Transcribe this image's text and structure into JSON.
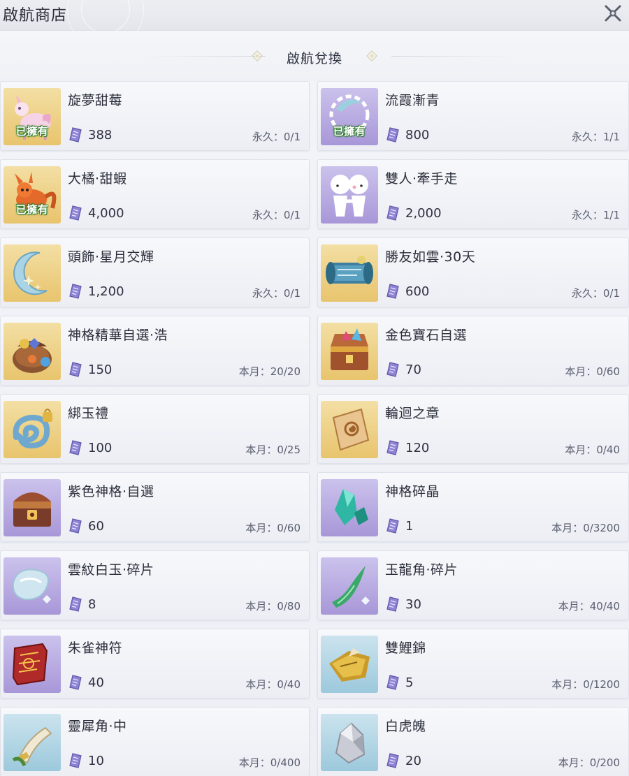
{
  "window": {
    "title": "啟航商店"
  },
  "section": {
    "title": "啟航兌換"
  },
  "owned_label": "已擁有",
  "colors": {
    "owned_outline": "#2f7d2e",
    "ticket": "#7b72c4"
  },
  "items": [
    {
      "name": "旋夢甜莓",
      "price": "388",
      "limit": "永久：0/1",
      "owned": true,
      "thumb_bg": "gold",
      "icon": "dream-berry-mount-icon"
    },
    {
      "name": "流霞漸青",
      "price": "800",
      "limit": "永久：1/1",
      "owned": true,
      "thumb_bg": "purple",
      "icon": "moon-wreath-icon"
    },
    {
      "name": "大橘·甜蝦",
      "price": "4,000",
      "limit": "永久：0/1",
      "owned": true,
      "thumb_bg": "gold",
      "icon": "orange-fox-pet-icon"
    },
    {
      "name": "雙人·牽手走",
      "price": "2,000",
      "limit": "永久：1/1",
      "owned": false,
      "thumb_bg": "purple",
      "icon": "holding-hands-emote-icon"
    },
    {
      "name": "頭飾·星月交輝",
      "price": "1,200",
      "limit": "永久：0/1",
      "owned": false,
      "thumb_bg": "gold",
      "icon": "crescent-moon-headwear-icon"
    },
    {
      "name": "勝友如雲·30天",
      "price": "600",
      "limit": "永久：0/1",
      "owned": false,
      "thumb_bg": "gold",
      "icon": "scroll-icon"
    },
    {
      "name": "神格精華自選·浩",
      "price": "150",
      "limit": "本月：20/20",
      "owned": false,
      "thumb_bg": "gold",
      "icon": "gem-pouch-icon"
    },
    {
      "name": "金色寶石自選",
      "price": "70",
      "limit": "本月：0/60",
      "owned": false,
      "thumb_bg": "gold",
      "icon": "treasure-chest-icon"
    },
    {
      "name": "綁玉禮",
      "price": "100",
      "limit": "本月：0/25",
      "owned": false,
      "thumb_bg": "gold",
      "icon": "jade-gift-icon"
    },
    {
      "name": "輪迴之章",
      "price": "120",
      "limit": "本月：0/40",
      "owned": false,
      "thumb_bg": "gold",
      "icon": "parchment-icon"
    },
    {
      "name": "紫色神格·自選",
      "price": "60",
      "limit": "本月：0/60",
      "owned": false,
      "thumb_bg": "purple",
      "icon": "purple-chest-icon"
    },
    {
      "name": "神格碎晶",
      "price": "1",
      "limit": "本月：0/3200",
      "owned": false,
      "thumb_bg": "purple",
      "icon": "crystal-shard-icon"
    },
    {
      "name": "雲紋白玉·碎片",
      "price": "8",
      "limit": "本月：0/80",
      "owned": false,
      "thumb_bg": "purple",
      "icon": "white-jade-fragment-icon"
    },
    {
      "name": "玉龍角·碎片",
      "price": "30",
      "limit": "本月：40/40",
      "owned": false,
      "thumb_bg": "purple",
      "icon": "jade-dragon-horn-icon"
    },
    {
      "name": "朱雀神符",
      "price": "40",
      "limit": "本月：0/40",
      "owned": false,
      "thumb_bg": "purple",
      "icon": "red-talisman-icon"
    },
    {
      "name": "雙鯉錦",
      "price": "5",
      "limit": "本月：0/1200",
      "owned": false,
      "thumb_bg": "teal",
      "icon": "golden-brocade-icon"
    },
    {
      "name": "靈犀角·中",
      "price": "10",
      "limit": "本月：0/400",
      "owned": false,
      "thumb_bg": "teal",
      "icon": "horn-icon"
    },
    {
      "name": "白虎魄",
      "price": "20",
      "limit": "本月：0/200",
      "owned": false,
      "thumb_bg": "teal",
      "icon": "silver-ore-icon"
    }
  ]
}
